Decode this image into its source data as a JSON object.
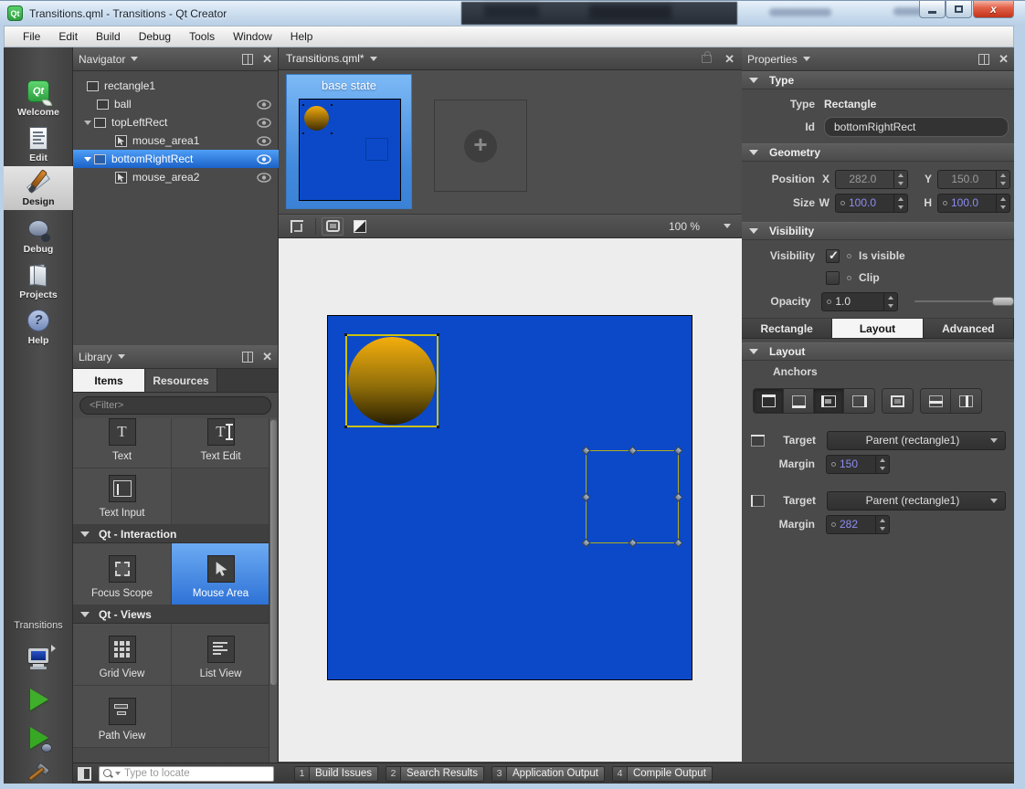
{
  "titlebar": {
    "title": "Transitions.qml - Transitions - Qt Creator"
  },
  "menubar": {
    "items": [
      "File",
      "Edit",
      "Build",
      "Debug",
      "Tools",
      "Window",
      "Help"
    ]
  },
  "modebar": {
    "modes": [
      {
        "label": "Welcome"
      },
      {
        "label": "Edit"
      },
      {
        "label": "Design"
      },
      {
        "label": "Debug"
      },
      {
        "label": "Projects"
      },
      {
        "label": "Help"
      }
    ],
    "project_label": "Transitions"
  },
  "navigator": {
    "title": "Navigator",
    "tree": [
      {
        "label": "rectangle1"
      },
      {
        "label": "ball"
      },
      {
        "label": "topLeftRect"
      },
      {
        "label": "mouse_area1"
      },
      {
        "label": "bottomRightRect"
      },
      {
        "label": "mouse_area2"
      }
    ]
  },
  "editor": {
    "tab_label": "Transitions.qml*",
    "zoom_level": "100 %",
    "states": {
      "base_label": "base state"
    }
  },
  "library": {
    "title": "Library",
    "tabs": [
      {
        "label": "Items"
      },
      {
        "label": "Resources"
      }
    ],
    "filter_placeholder": "<Filter>",
    "items": [
      {
        "label": "Text"
      },
      {
        "label": "Text Edit"
      },
      {
        "label": "Text Input"
      },
      {
        "label": "Focus Scope"
      },
      {
        "label": "Mouse Area"
      },
      {
        "label": "Grid View"
      },
      {
        "label": "List View"
      },
      {
        "label": "Path View"
      }
    ],
    "sections": [
      {
        "title": "Qt - Interaction"
      },
      {
        "title": "Qt - Views"
      }
    ]
  },
  "properties": {
    "title": "Properties",
    "type_section": {
      "header": "Type",
      "type_label": "Type",
      "type_value": "Rectangle",
      "id_label": "Id",
      "id_value": "bottomRightRect"
    },
    "geometry": {
      "header": "Geometry",
      "position_label": "Position",
      "x_label": "X",
      "x_value": "282.0",
      "y_label": "Y",
      "y_value": "150.0",
      "size_label": "Size",
      "w_label": "W",
      "w_value": "100.0",
      "h_label": "H",
      "h_value": "100.0"
    },
    "visibility": {
      "header": "Visibility",
      "visibility_label": "Visibility",
      "is_visible_label": "Is visible",
      "clip_label": "Clip",
      "opacity_label": "Opacity",
      "opacity_value": "1.0"
    },
    "tabs": [
      {
        "label": "Rectangle"
      },
      {
        "label": "Layout"
      },
      {
        "label": "Advanced"
      }
    ],
    "layout": {
      "header": "Layout",
      "anchors_label": "Anchors",
      "groups": [
        {
          "target_label": "Target",
          "target_value": "Parent (rectangle1)",
          "margin_label": "Margin",
          "margin_value": "150"
        },
        {
          "target_label": "Target",
          "target_value": "Parent (rectangle1)",
          "margin_label": "Margin",
          "margin_value": "282"
        }
      ]
    }
  },
  "statusbar": {
    "locator_placeholder": "Type to locate",
    "panes": [
      {
        "num": "1",
        "label": "Build Issues"
      },
      {
        "num": "2",
        "label": "Search Results"
      },
      {
        "num": "3",
        "label": "Application Output"
      },
      {
        "num": "4",
        "label": "Compile Output"
      }
    ]
  },
  "colors": {
    "canvas_blue": "#0b49c8",
    "ball_gold": "#f2ab0e",
    "selection_yellow": "#cdc00e",
    "highlight_blue": "#2e72d6"
  }
}
